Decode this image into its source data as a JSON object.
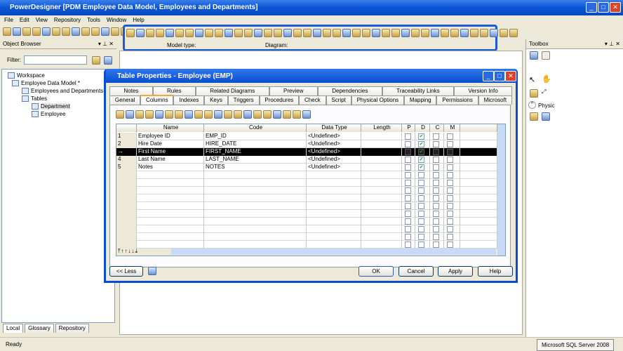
{
  "app": {
    "title": "PowerDesigner [PDM Employee Data Model, Employees and Departments]"
  },
  "menu": [
    "File",
    "Edit",
    "View",
    "Repository",
    "Tools",
    "Window",
    "Help"
  ],
  "diagram_header": {
    "model_type_label": "Model type:",
    "diagram_label": "Diagram:"
  },
  "object_browser": {
    "title": "Object Browser",
    "filter_label": "Filter:",
    "filter_value": "",
    "tree": [
      "Workspace",
      "Employee Data Model *",
      "Employees and Departments",
      "Tables",
      "Department",
      "Employee"
    ],
    "bottom_tabs": [
      "Local",
      "Glossary",
      "Repository"
    ]
  },
  "toolbox": {
    "title": "Toolbox",
    "section": "Physic"
  },
  "dialog": {
    "title": "Table Properties - Employee (EMP)",
    "tabs_row1": [
      "Notes",
      "Rules",
      "Related Diagrams",
      "Preview",
      "Dependencies",
      "Traceability Links",
      "Version Info"
    ],
    "tabs_row2": [
      "General",
      "Columns",
      "Indexes",
      "Keys",
      "Triggers",
      "Procedures",
      "Check",
      "Script",
      "Physical Options",
      "Mapping",
      "Permissions",
      "Microsoft"
    ],
    "active_tab": "Columns",
    "columns": [
      "Name",
      "Code",
      "Data Type",
      "Length",
      "P",
      "D",
      "C",
      "M"
    ],
    "rows": [
      {
        "num": "1",
        "name": "Employee ID",
        "code": "EMP_ID",
        "type": "<Undefined>",
        "length": "",
        "p": false,
        "d": true,
        "c": false,
        "m": false
      },
      {
        "num": "2",
        "name": "Hire Date",
        "code": "HIRE_DATE",
        "type": "<Undefined>",
        "length": "",
        "p": false,
        "d": true,
        "c": false,
        "m": false
      },
      {
        "num": "→",
        "name": "First Name",
        "code": "FIRST_NAME",
        "type": "<Undefined>",
        "length": "",
        "p": false,
        "d": true,
        "c": false,
        "m": false,
        "selected": true
      },
      {
        "num": "4",
        "name": "Last Name",
        "code": "LAST_NAME",
        "type": "<Undefined>",
        "length": "",
        "p": false,
        "d": true,
        "c": false,
        "m": false
      },
      {
        "num": "5",
        "name": "Notes",
        "code": "NOTES",
        "type": "<Undefined>",
        "length": "",
        "p": false,
        "d": true,
        "c": false,
        "m": false
      }
    ],
    "less_label": "<< Less",
    "ok": "OK",
    "cancel": "Cancel",
    "apply": "Apply",
    "help": "Help"
  },
  "status": {
    "text": "Ready",
    "dbms": "Microsoft SQL Server 2008"
  }
}
